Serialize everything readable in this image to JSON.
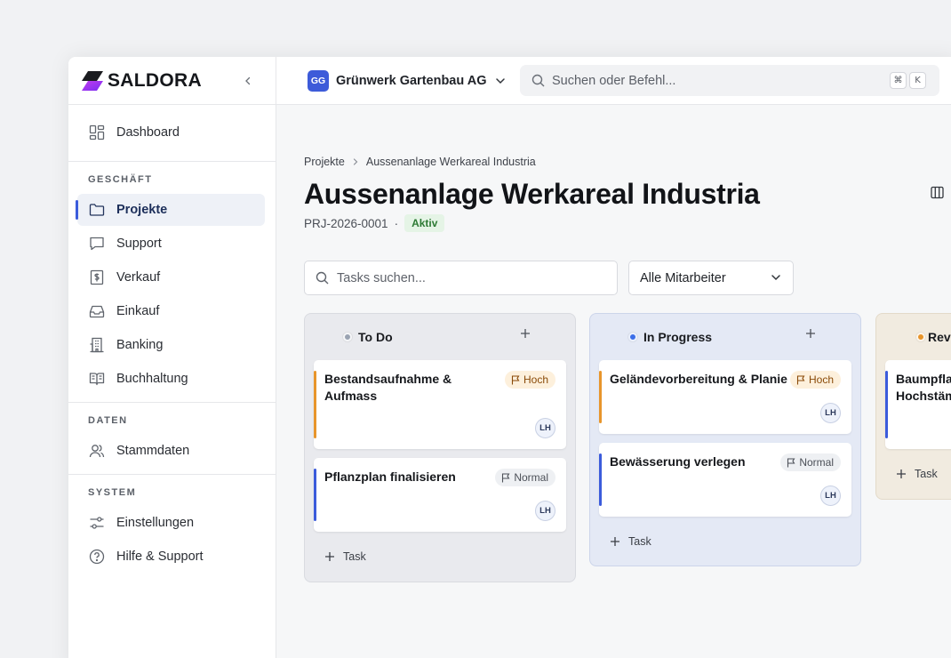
{
  "brand": {
    "name": "SALDORA"
  },
  "sidebar": {
    "top": {
      "label": "Dashboard",
      "icon": "dashboard-grid-icon"
    },
    "sections": [
      {
        "title": "GESCHÄFT",
        "items": [
          {
            "label": "Projekte",
            "icon": "folder-icon",
            "active": true
          },
          {
            "label": "Support",
            "icon": "chat-bubble-icon"
          },
          {
            "label": "Verkauf",
            "icon": "dollar-document-icon"
          },
          {
            "label": "Einkauf",
            "icon": "inbox-tray-icon"
          },
          {
            "label": "Banking",
            "icon": "building-icon"
          },
          {
            "label": "Buchhaltung",
            "icon": "open-book-icon"
          }
        ]
      },
      {
        "title": "DATEN",
        "items": [
          {
            "label": "Stammdaten",
            "icon": "users-icon"
          }
        ]
      },
      {
        "title": "SYSTEM",
        "items": [
          {
            "label": "Einstellungen",
            "icon": "sliders-icon"
          },
          {
            "label": "Hilfe & Support",
            "icon": "help-circle-icon"
          }
        ]
      }
    ]
  },
  "topbar": {
    "company_initials": "GG",
    "company_name": "Grünwerk Gartenbau AG",
    "search_placeholder": "Suchen oder Befehl...",
    "shortcut_keys": [
      "⌘",
      "K"
    ]
  },
  "page": {
    "breadcrumb": [
      "Projekte",
      "Aussenanlage Werkareal Industria"
    ],
    "title": "Aussenanlage Werkareal Industria",
    "project_id": "PRJ-2026-0001",
    "separator": "·",
    "status": "Aktiv",
    "task_search_placeholder": "Tasks suchen...",
    "assignee_filter": "Alle Mitarbeiter"
  },
  "board": {
    "add_task_label": "Task",
    "columns": [
      {
        "title": "To Do",
        "color": "#9aa3b2",
        "cards": [
          {
            "title": "Bestandsaufnahme & Aufmass",
            "priority": "Hoch",
            "assignee": "LH"
          },
          {
            "title": "Pflanzplan finalisieren",
            "priority": "Normal",
            "assignee": "LH"
          }
        ]
      },
      {
        "title": "In Progress",
        "color": "#3b6ee8",
        "cards": [
          {
            "title": "Geländevorbereitung & Planie",
            "priority": "Hoch",
            "assignee": "LH"
          },
          {
            "title": "Bewässerung verlegen",
            "priority": "Normal",
            "assignee": "LH"
          }
        ]
      },
      {
        "title": "Review",
        "color": "#e8952b",
        "cards": [
          {
            "title": "Baumpflanzung Hochstämme",
            "priority": "",
            "assignee": ""
          }
        ]
      }
    ]
  }
}
